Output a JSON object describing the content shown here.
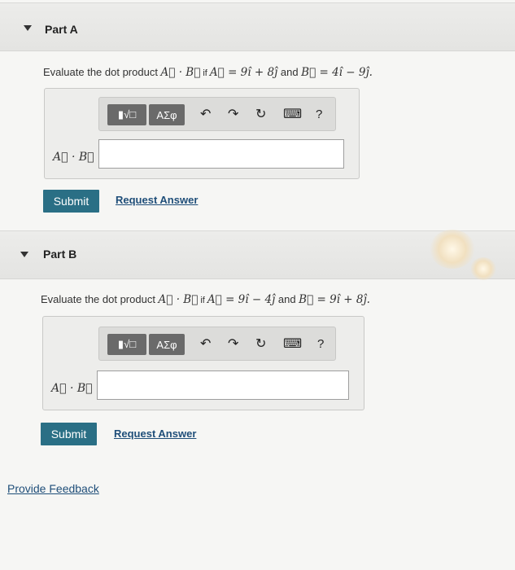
{
  "partA": {
    "title": "Part A",
    "question_prefix": "Evaluate the dot product ",
    "dot_expr": "A⃗ · B⃗",
    "if_text": " if ",
    "a_expr": "A⃗ = 9î + 8ĵ",
    "and_text": " and ",
    "b_expr": "B⃗ = 4î − 9ĵ.",
    "label": "A⃗ · B⃗ =",
    "input_value": "",
    "submit_label": "Submit",
    "request_label": "Request Answer"
  },
  "partB": {
    "title": "Part B",
    "question_prefix": "Evaluate the dot product ",
    "dot_expr": "A⃗ · B⃗",
    "if_text": " if ",
    "a_expr": "A⃗ = 9î − 4ĵ",
    "and_text": " and ",
    "b_expr": "B⃗ = 9î + 8ĵ.",
    "label": "A⃗ · B⃗ =",
    "input_value": "",
    "submit_label": "Submit",
    "request_label": "Request Answer"
  },
  "toolbar": {
    "template_glyph": "▮√□",
    "greek_label": "ΑΣφ",
    "undo_glyph": "↶",
    "redo_glyph": "↷",
    "reset_glyph": "↻",
    "keyboard_glyph": "⌨",
    "help_glyph": "?"
  },
  "feedback_label": "Provide Feedback",
  "colors": {
    "submit": "#2a6f85",
    "link": "#1f4e79",
    "toolbar_button": "#6a6a6a"
  }
}
